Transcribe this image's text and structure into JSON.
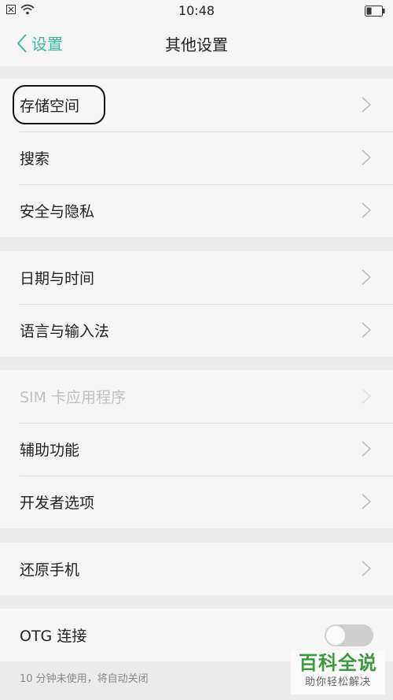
{
  "status_bar": {
    "time": "10:48",
    "icons": [
      "sim-off-icon",
      "wifi-icon",
      "battery-icon"
    ]
  },
  "nav": {
    "back_label": "设置",
    "title": "其他设置"
  },
  "groups": [
    {
      "items": [
        {
          "label": "存储空间"
        },
        {
          "label": "搜索"
        },
        {
          "label": "安全与隐私"
        }
      ]
    },
    {
      "items": [
        {
          "label": "日期与时间"
        },
        {
          "label": "语言与输入法"
        }
      ]
    },
    {
      "items": [
        {
          "label": "SIM 卡应用程序",
          "disabled": true
        },
        {
          "label": "辅助功能"
        },
        {
          "label": "开发者选项"
        }
      ]
    },
    {
      "items": [
        {
          "label": "还原手机"
        }
      ]
    },
    {
      "items": [
        {
          "label": "OTG 连接",
          "toggle": "off"
        }
      ]
    }
  ],
  "otg_hint": "10 分钟未使用，将自动关闭",
  "watermark": {
    "title": "百科全说",
    "subtitle": "助你轻松解决"
  },
  "colors": {
    "accent": "#3cb8a0",
    "background": "#ebebeb",
    "row_background": "#f6f6f6",
    "watermark_green": "#3c9a3c"
  }
}
